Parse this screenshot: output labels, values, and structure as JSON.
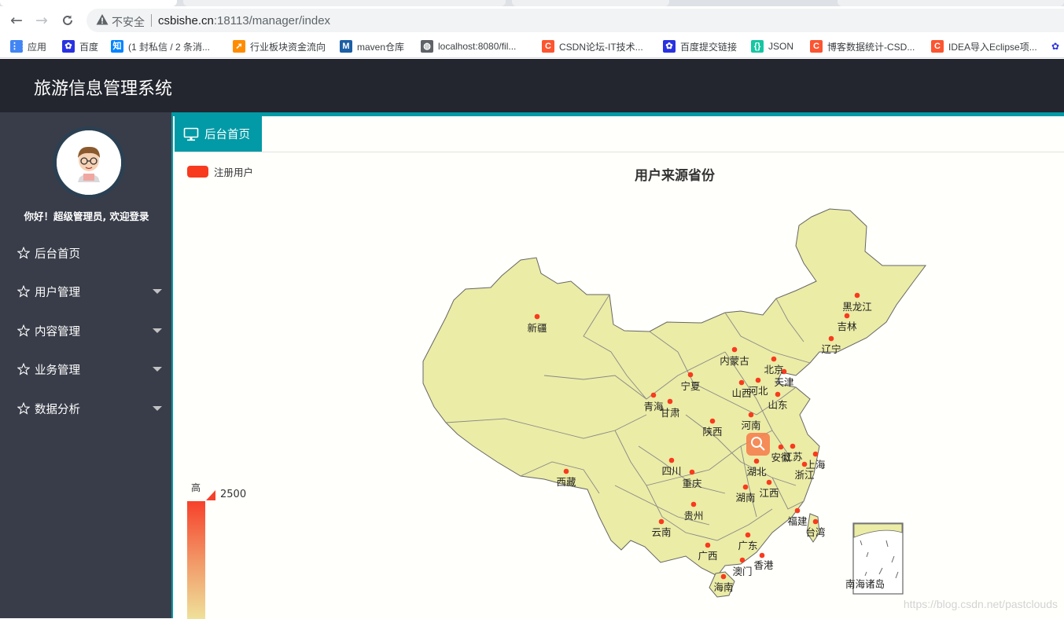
{
  "browser": {
    "insecure_label": "不安全",
    "url_host": "csbishe.cn",
    "url_path": ":18113/manager/index",
    "bookmarks": [
      {
        "label": "应用",
        "icon": "apps-grid-icon",
        "color": "#4285f4"
      },
      {
        "label": "百度",
        "icon": "baidu-paw-icon",
        "color": "#2932e1"
      },
      {
        "label": "(1 封私信 / 2 条消...",
        "icon": "zhihu-icon",
        "color": "#0084ff"
      },
      {
        "label": "行业板块资金流向",
        "icon": "stock-flow-icon",
        "color": "#ff8c00"
      },
      {
        "label": "maven仓库",
        "icon": "mvn-icon",
        "color": "#1b5fa5"
      },
      {
        "label": "localhost:8080/fil...",
        "icon": "globe-icon",
        "color": "#5f6368"
      },
      {
        "label": "CSDN论坛-IT技术...",
        "icon": "csdn-icon",
        "color": "#fc5531"
      },
      {
        "label": "百度提交链接",
        "icon": "baidu-paw-icon",
        "color": "#2932e1"
      },
      {
        "label": "JSON",
        "icon": "json-icon",
        "color": "#17c6a3"
      },
      {
        "label": "博客数据统计-CSD...",
        "icon": "csdn-icon",
        "color": "#fc5531"
      },
      {
        "label": "IDEA导入Eclipse项...",
        "icon": "csdn-icon",
        "color": "#fc5531"
      }
    ]
  },
  "app": {
    "title": "旅游信息管理系统",
    "welcome": "你好！超级管理员, 欢迎登录",
    "menu": [
      {
        "label": "后台首页",
        "has_submenu": false
      },
      {
        "label": "用户管理",
        "has_submenu": true
      },
      {
        "label": "内容管理",
        "has_submenu": true
      },
      {
        "label": "业务管理",
        "has_submenu": true
      },
      {
        "label": "数据分析",
        "has_submenu": true
      }
    ],
    "active_tab": "后台首页",
    "accent_color": "#019aa6",
    "header_color": "#23262e",
    "sidebar_color": "#393d49"
  },
  "chart_data": {
    "type": "map",
    "title": "用户来源省份",
    "legend": [
      {
        "name": "注册用户",
        "color": "#f83b1e"
      }
    ],
    "visual_map": {
      "high_label": "高",
      "max": 2500
    },
    "map_fill": "#ebeca6",
    "marker_color": "#f83b1e",
    "provinces": [
      "黑龙江",
      "吉林",
      "辽宁",
      "新疆",
      "内蒙古",
      "北京",
      "天津",
      "河北",
      "山西",
      "宁夏",
      "青海",
      "甘肃",
      "山东",
      "陕西",
      "河南",
      "江苏",
      "安徽",
      "上海",
      "湖北",
      "浙江",
      "西藏",
      "四川",
      "重庆",
      "江西",
      "湖南",
      "贵州",
      "福建",
      "台湾",
      "云南",
      "广东",
      "广西",
      "香港",
      "澳门",
      "海南"
    ],
    "inset_label": "南海诸岛"
  },
  "watermark": "https://blog.csdn.net/pastclouds"
}
